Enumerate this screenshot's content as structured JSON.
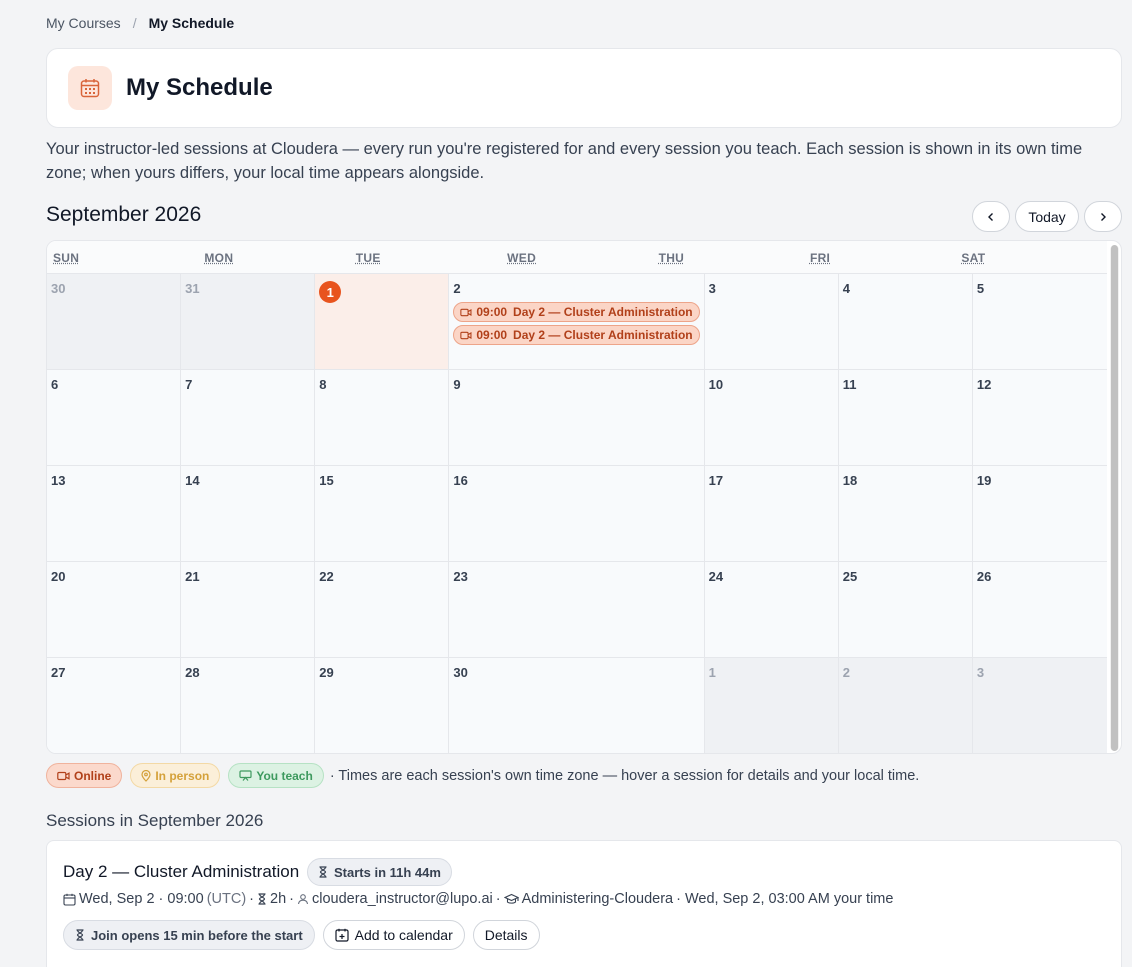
{
  "breadcrumb": {
    "parent": "My Courses",
    "separator": "/",
    "current": "My Schedule"
  },
  "header": {
    "title": "My Schedule",
    "icon": "calendar-icon"
  },
  "intro": "Your instructor-led sessions at Cloudera — every run you're registered for and every session you teach. Each session is shown in its own time zone; when yours differs, your local time appears alongside.",
  "calendar": {
    "month_label": "September 2026",
    "nav": {
      "prev_icon": "chevron-left-icon",
      "today_label": "Today",
      "next_icon": "chevron-right-icon"
    },
    "weekdays": [
      "SUN",
      "MON",
      "TUE",
      "WED",
      "THU",
      "FRI",
      "SAT"
    ],
    "weeks": [
      [
        {
          "day": "30",
          "other": true
        },
        {
          "day": "31",
          "other": true
        },
        {
          "day": "1",
          "today": true
        },
        {
          "day": "2",
          "events": [
            {
              "time": "09:00",
              "title": "Day 2 — Cluster Administration"
            },
            {
              "time": "09:00",
              "title": "Day 2 — Cluster Administration"
            }
          ]
        },
        {
          "day": "3"
        },
        {
          "day": "4"
        },
        {
          "day": "5"
        }
      ],
      [
        {
          "day": "6"
        },
        {
          "day": "7"
        },
        {
          "day": "8"
        },
        {
          "day": "9"
        },
        {
          "day": "10"
        },
        {
          "day": "11"
        },
        {
          "day": "12"
        }
      ],
      [
        {
          "day": "13"
        },
        {
          "day": "14"
        },
        {
          "day": "15"
        },
        {
          "day": "16"
        },
        {
          "day": "17"
        },
        {
          "day": "18"
        },
        {
          "day": "19"
        }
      ],
      [
        {
          "day": "20"
        },
        {
          "day": "21"
        },
        {
          "day": "22"
        },
        {
          "day": "23"
        },
        {
          "day": "24"
        },
        {
          "day": "25"
        },
        {
          "day": "26"
        }
      ],
      [
        {
          "day": "27"
        },
        {
          "day": "28"
        },
        {
          "day": "29"
        },
        {
          "day": "30"
        },
        {
          "day": "1",
          "other": true
        },
        {
          "day": "2",
          "other": true
        },
        {
          "day": "3",
          "other": true
        }
      ]
    ]
  },
  "legend": {
    "online": "Online",
    "in_person": "In person",
    "you_teach": "You teach",
    "note": "· Times are each session's own time zone — hover a session for details and your local time."
  },
  "sessions": {
    "section_title": "Sessions in September 2026",
    "items": [
      {
        "title": "Day 2 — Cluster Administration",
        "starts_in": "Starts in 11h 44m",
        "date": "Wed, Sep 2 · 09:00",
        "tz": "(UTC)",
        "sep1": "·",
        "duration": "2h",
        "sep2": "·",
        "instructor": "cloudera_instructor@lupo.ai",
        "sep3": "·",
        "course": "Administering-Cloudera",
        "local_time": "· Wed, Sep 2, 03:00 AM your time",
        "join_label": "Join opens 15 min before the start",
        "add_calendar_label": "Add to calendar",
        "details_label": "Details"
      }
    ]
  },
  "colors": {
    "accent": "#e8541e",
    "online_bg": "#fbd9cc",
    "in_person_bg": "#fbefd9",
    "teach_bg": "#dcf2e3"
  }
}
